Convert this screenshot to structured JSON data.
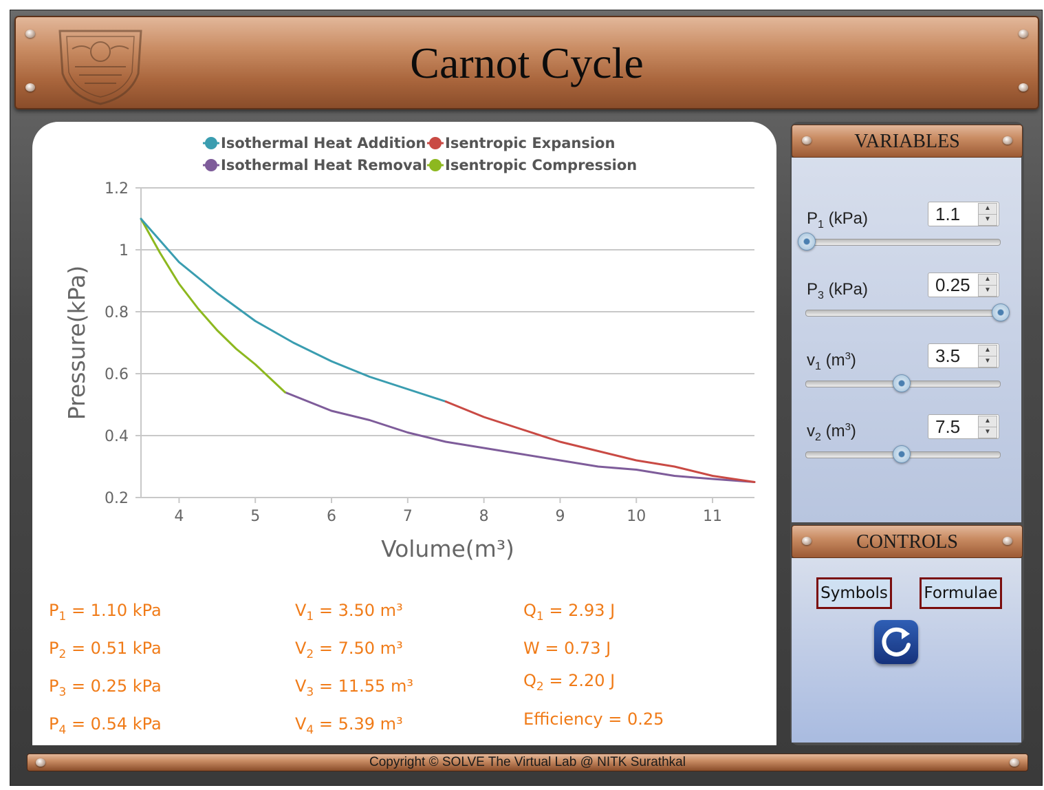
{
  "header": {
    "title": "Carnot Cycle"
  },
  "chart_data": {
    "type": "line",
    "xlabel": "Volume(m³)",
    "ylabel": "Pressure(kPa)",
    "xlim": [
      3.5,
      11.55
    ],
    "ylim": [
      0.2,
      1.2
    ],
    "x_ticks": [
      "4",
      "5",
      "6",
      "7",
      "8",
      "9",
      "10",
      "11"
    ],
    "y_ticks": [
      "0.2",
      "0.4",
      "0.6",
      "0.8",
      "1",
      "1.2"
    ],
    "grid": "horizontal",
    "legend_position": "top",
    "series": [
      {
        "name": "Isothermal Heat Addition",
        "color": "#3a9db0",
        "x": [
          3.5,
          4.0,
          4.5,
          5.0,
          5.5,
          6.0,
          6.5,
          7.0,
          7.5
        ],
        "y": [
          1.1,
          0.96,
          0.86,
          0.77,
          0.7,
          0.64,
          0.59,
          0.55,
          0.51
        ]
      },
      {
        "name": "Isentropic Expansion",
        "color": "#c94a44",
        "x": [
          7.5,
          8.0,
          8.5,
          9.0,
          9.5,
          10.0,
          10.5,
          11.0,
          11.55
        ],
        "y": [
          0.51,
          0.46,
          0.42,
          0.38,
          0.35,
          0.32,
          0.3,
          0.27,
          0.25
        ]
      },
      {
        "name": "Isothermal Heat Removal",
        "color": "#7e5c9a",
        "x": [
          5.39,
          6.0,
          6.5,
          7.0,
          7.5,
          8.0,
          8.5,
          9.0,
          9.5,
          10.0,
          10.5,
          11.0,
          11.55
        ],
        "y": [
          0.54,
          0.48,
          0.45,
          0.41,
          0.38,
          0.36,
          0.34,
          0.32,
          0.3,
          0.29,
          0.27,
          0.26,
          0.25
        ]
      },
      {
        "name": "Isentropic Compression",
        "color": "#8db81f",
        "x": [
          3.5,
          3.75,
          4.0,
          4.25,
          4.5,
          4.75,
          5.0,
          5.39
        ],
        "y": [
          1.1,
          0.99,
          0.89,
          0.81,
          0.74,
          0.68,
          0.63,
          0.54
        ]
      }
    ]
  },
  "results": {
    "col1": [
      {
        "sym": "P",
        "sub": "1",
        "rest": " = 1.10 kPa"
      },
      {
        "sym": "P",
        "sub": "2",
        "rest": " = 0.51 kPa"
      },
      {
        "sym": "P",
        "sub": "3",
        "rest": " = 0.25 kPa"
      },
      {
        "sym": "P",
        "sub": "4",
        "rest": " = 0.54 kPa"
      }
    ],
    "col2": [
      {
        "sym": "V",
        "sub": "1",
        "rest": " = 3.50 m³"
      },
      {
        "sym": "V",
        "sub": "2",
        "rest": " = 7.50 m³"
      },
      {
        "sym": "V",
        "sub": "3",
        "rest": " = 11.55 m³"
      },
      {
        "sym": "V",
        "sub": "4",
        "rest": " = 5.39 m³"
      }
    ],
    "col3": [
      {
        "sym": "Q",
        "sub": "1",
        "rest": " = 2.93 J"
      },
      {
        "sym": "",
        "sub": "",
        "rest": "W = 0.73 J"
      },
      {
        "sym": "Q",
        "sub": "2",
        "rest": " = 2.20 J"
      },
      {
        "sym": "",
        "sub": "",
        "rest": "Efficiency = 0.25"
      }
    ]
  },
  "variables": {
    "header": "VARIABLES",
    "items": [
      {
        "sym": "P",
        "sub": "1",
        "unit": " (kPa)",
        "sup": "",
        "unit_end": "",
        "value": "1.1",
        "slider": 0.0
      },
      {
        "sym": "P",
        "sub": "3",
        "unit": " (kPa)",
        "sup": "",
        "unit_end": "",
        "value": "0.25",
        "slider": 1.0
      },
      {
        "sym": "v",
        "sub": "1",
        "unit": " (m",
        "sup": "3",
        "unit_end": ")",
        "value": "3.5",
        "slider": 0.49
      },
      {
        "sym": "v",
        "sub": "2",
        "unit": " (m",
        "sup": "3",
        "unit_end": ")",
        "value": "7.5",
        "slider": 0.49
      }
    ],
    "spin_up_icon": "up-arrow-icon",
    "spin_down_icon": "down-arrow-icon"
  },
  "controls": {
    "header": "CONTROLS",
    "symbols_label": "Symbols",
    "formulae_label": "Formulae",
    "reset_icon": "reset-icon"
  },
  "footer": {
    "text": "Copyright © SOLVE The Virtual Lab @ NITK Surathkal"
  }
}
